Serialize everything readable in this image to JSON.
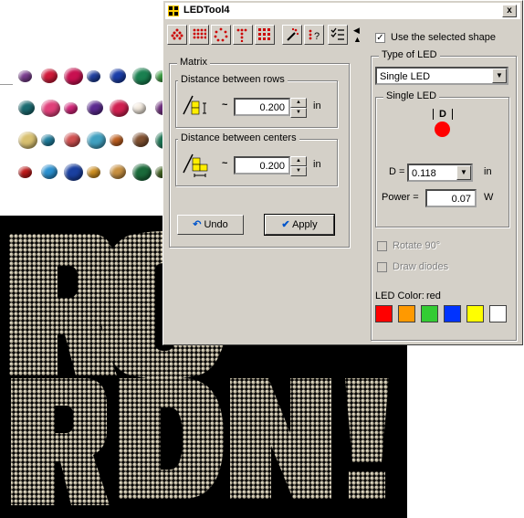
{
  "window": {
    "title": "LEDTool4",
    "close_label": "x"
  },
  "toolbar": {
    "buttons": [
      {
        "name": "matrix-shape-icon",
        "color": "#cc0000"
      },
      {
        "name": "grid-icon",
        "color": "#cc0000"
      },
      {
        "name": "circle-dots-icon",
        "color": "#cc0000"
      },
      {
        "name": "text-t-icon",
        "color": "#cc0000"
      },
      {
        "name": "square-grid-icon",
        "color": "#cc0000"
      },
      {
        "name": "magic-wand-icon",
        "color": "#cc0000"
      },
      {
        "name": "help-shape-icon",
        "color": "#cc0000"
      },
      {
        "name": "checklist-icon",
        "color": "#000000"
      }
    ],
    "arrow_up": "◀",
    "arrow_down": "▲"
  },
  "matrix": {
    "label": "Matrix",
    "rows": {
      "label": "Distance between rows",
      "symbol": "~",
      "value": "0.200",
      "unit": "in"
    },
    "centers": {
      "label": "Distance between centers",
      "symbol": "~",
      "value": "0.200",
      "unit": "in"
    },
    "undo_label": "Undo",
    "apply_label": "Apply"
  },
  "options": {
    "use_selected_shape": {
      "label": "Use the selected shape",
      "checked": true
    },
    "type_of_led": {
      "label": "Type of LED",
      "selected": "Single LED"
    },
    "single_led": {
      "label": "Single LED",
      "diagram_label": "D",
      "d_label": "D =",
      "d_value": "0.118",
      "d_unit": "in",
      "power_label": "Power =",
      "power_value": "0.07",
      "power_unit": "W"
    },
    "rotate": {
      "label": "Rotate 90°",
      "checked": false
    },
    "draw_diodes": {
      "label": "Draw diodes",
      "checked": false
    },
    "led_color": {
      "label": "LED Color:",
      "value": "red",
      "swatches": [
        "#ff0000",
        "#ff9900",
        "#33cc33",
        "#0033ff",
        "#ffff00",
        "#ffffff"
      ]
    }
  }
}
